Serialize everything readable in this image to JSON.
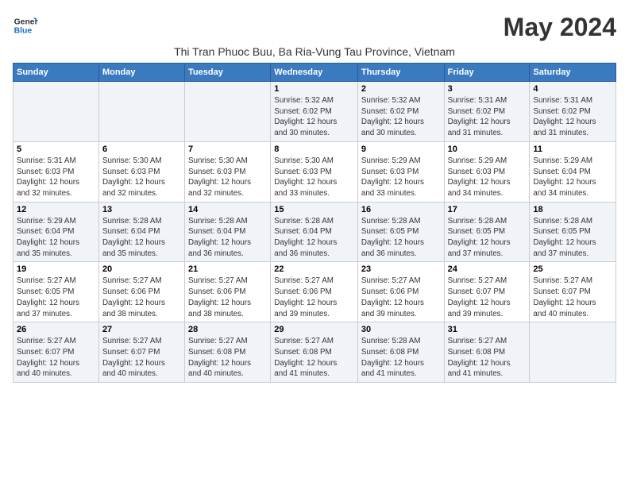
{
  "logo": {
    "line1": "General",
    "line2": "Blue"
  },
  "title": "May 2024",
  "subtitle": "Thi Tran Phuoc Buu, Ba Ria-Vung Tau Province, Vietnam",
  "days_of_week": [
    "Sunday",
    "Monday",
    "Tuesday",
    "Wednesday",
    "Thursday",
    "Friday",
    "Saturday"
  ],
  "weeks": [
    [
      {
        "num": "",
        "info": ""
      },
      {
        "num": "",
        "info": ""
      },
      {
        "num": "",
        "info": ""
      },
      {
        "num": "1",
        "info": "Sunrise: 5:32 AM\nSunset: 6:02 PM\nDaylight: 12 hours\nand 30 minutes."
      },
      {
        "num": "2",
        "info": "Sunrise: 5:32 AM\nSunset: 6:02 PM\nDaylight: 12 hours\nand 30 minutes."
      },
      {
        "num": "3",
        "info": "Sunrise: 5:31 AM\nSunset: 6:02 PM\nDaylight: 12 hours\nand 31 minutes."
      },
      {
        "num": "4",
        "info": "Sunrise: 5:31 AM\nSunset: 6:02 PM\nDaylight: 12 hours\nand 31 minutes."
      }
    ],
    [
      {
        "num": "5",
        "info": "Sunrise: 5:31 AM\nSunset: 6:03 PM\nDaylight: 12 hours\nand 32 minutes."
      },
      {
        "num": "6",
        "info": "Sunrise: 5:30 AM\nSunset: 6:03 PM\nDaylight: 12 hours\nand 32 minutes."
      },
      {
        "num": "7",
        "info": "Sunrise: 5:30 AM\nSunset: 6:03 PM\nDaylight: 12 hours\nand 32 minutes."
      },
      {
        "num": "8",
        "info": "Sunrise: 5:30 AM\nSunset: 6:03 PM\nDaylight: 12 hours\nand 33 minutes."
      },
      {
        "num": "9",
        "info": "Sunrise: 5:29 AM\nSunset: 6:03 PM\nDaylight: 12 hours\nand 33 minutes."
      },
      {
        "num": "10",
        "info": "Sunrise: 5:29 AM\nSunset: 6:03 PM\nDaylight: 12 hours\nand 34 minutes."
      },
      {
        "num": "11",
        "info": "Sunrise: 5:29 AM\nSunset: 6:04 PM\nDaylight: 12 hours\nand 34 minutes."
      }
    ],
    [
      {
        "num": "12",
        "info": "Sunrise: 5:29 AM\nSunset: 6:04 PM\nDaylight: 12 hours\nand 35 minutes."
      },
      {
        "num": "13",
        "info": "Sunrise: 5:28 AM\nSunset: 6:04 PM\nDaylight: 12 hours\nand 35 minutes."
      },
      {
        "num": "14",
        "info": "Sunrise: 5:28 AM\nSunset: 6:04 PM\nDaylight: 12 hours\nand 36 minutes."
      },
      {
        "num": "15",
        "info": "Sunrise: 5:28 AM\nSunset: 6:04 PM\nDaylight: 12 hours\nand 36 minutes."
      },
      {
        "num": "16",
        "info": "Sunrise: 5:28 AM\nSunset: 6:05 PM\nDaylight: 12 hours\nand 36 minutes."
      },
      {
        "num": "17",
        "info": "Sunrise: 5:28 AM\nSunset: 6:05 PM\nDaylight: 12 hours\nand 37 minutes."
      },
      {
        "num": "18",
        "info": "Sunrise: 5:28 AM\nSunset: 6:05 PM\nDaylight: 12 hours\nand 37 minutes."
      }
    ],
    [
      {
        "num": "19",
        "info": "Sunrise: 5:27 AM\nSunset: 6:05 PM\nDaylight: 12 hours\nand 37 minutes."
      },
      {
        "num": "20",
        "info": "Sunrise: 5:27 AM\nSunset: 6:06 PM\nDaylight: 12 hours\nand 38 minutes."
      },
      {
        "num": "21",
        "info": "Sunrise: 5:27 AM\nSunset: 6:06 PM\nDaylight: 12 hours\nand 38 minutes."
      },
      {
        "num": "22",
        "info": "Sunrise: 5:27 AM\nSunset: 6:06 PM\nDaylight: 12 hours\nand 39 minutes."
      },
      {
        "num": "23",
        "info": "Sunrise: 5:27 AM\nSunset: 6:06 PM\nDaylight: 12 hours\nand 39 minutes."
      },
      {
        "num": "24",
        "info": "Sunrise: 5:27 AM\nSunset: 6:07 PM\nDaylight: 12 hours\nand 39 minutes."
      },
      {
        "num": "25",
        "info": "Sunrise: 5:27 AM\nSunset: 6:07 PM\nDaylight: 12 hours\nand 40 minutes."
      }
    ],
    [
      {
        "num": "26",
        "info": "Sunrise: 5:27 AM\nSunset: 6:07 PM\nDaylight: 12 hours\nand 40 minutes."
      },
      {
        "num": "27",
        "info": "Sunrise: 5:27 AM\nSunset: 6:07 PM\nDaylight: 12 hours\nand 40 minutes."
      },
      {
        "num": "28",
        "info": "Sunrise: 5:27 AM\nSunset: 6:08 PM\nDaylight: 12 hours\nand 40 minutes."
      },
      {
        "num": "29",
        "info": "Sunrise: 5:27 AM\nSunset: 6:08 PM\nDaylight: 12 hours\nand 41 minutes."
      },
      {
        "num": "30",
        "info": "Sunrise: 5:28 AM\nSunset: 6:08 PM\nDaylight: 12 hours\nand 41 minutes."
      },
      {
        "num": "31",
        "info": "Sunrise: 5:27 AM\nSunset: 6:08 PM\nDaylight: 12 hours\nand 41 minutes."
      },
      {
        "num": "",
        "info": ""
      }
    ]
  ]
}
